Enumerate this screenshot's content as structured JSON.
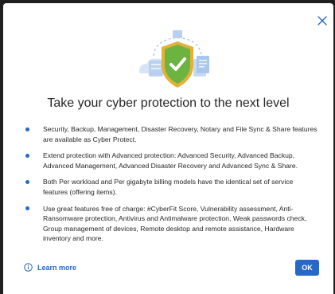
{
  "dialog": {
    "title": "Take your cyber protection to the next level",
    "features": [
      "Security, Backup, Management, Disaster Recovery, Notary and File Sync & Share features are available as Cyber Protect.",
      "Extend protection with Advanced protection: Advanced Security, Advanced Backup, Advanced Management, Advanced Disaster Recovery and Advanced Sync & Share.",
      "Both Per workload and Per gigabyte billing models have the identical set of service features (offering items).",
      "Use great features free of charge: #CyberFit Score, Vulnerability assessment, Anti-Ransomware protection, Antivirus and Antimalware protection, Weak passwords check, Group management of devices, Remote desktop and remote assistance, Hardware inventory and more."
    ],
    "learn_more_label": "Learn more",
    "ok_label": "OK"
  },
  "icons": {
    "close": "close-icon",
    "hero": "shield-check-icon",
    "info": "info-icon"
  },
  "colors": {
    "accent": "#2668c5",
    "shield_green": "#6cb33f",
    "shield_gold": "#e0b23a",
    "text": "#262626"
  }
}
